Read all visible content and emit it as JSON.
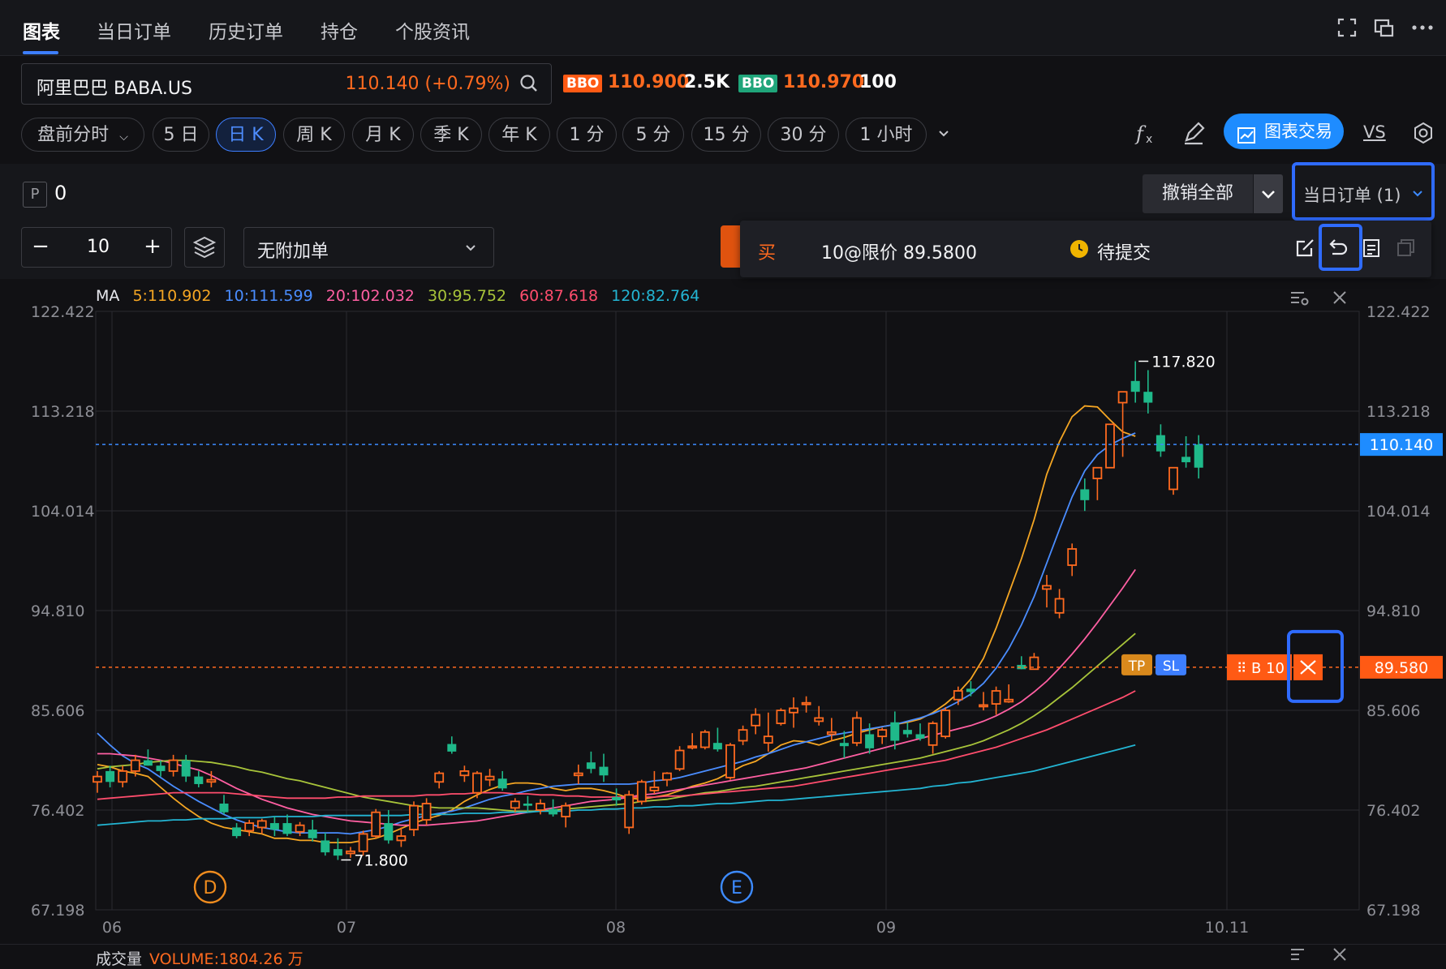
{
  "tabs": [
    {
      "label": "图表",
      "active": true
    },
    {
      "label": "当日订单",
      "active": false
    },
    {
      "label": "历史订单",
      "active": false
    },
    {
      "label": "持仓",
      "active": false
    },
    {
      "label": "个股资讯",
      "active": false
    }
  ],
  "top_icons": [
    "fullscreen-icon",
    "popout-icon",
    "more-icon"
  ],
  "symbol": {
    "name": "阿里巴巴 BABA.US",
    "price": "110.140 (+0.79%)"
  },
  "bbo": [
    {
      "tag": "BBO",
      "price": "110.900",
      "size": "2.5K",
      "color": "#ff6a1f"
    },
    {
      "tag": "BBO",
      "price": "110.970",
      "size": "100",
      "color": "#1fb98a"
    }
  ],
  "periods": [
    {
      "label": "盘前分时",
      "active": false,
      "dropdown": true
    },
    {
      "label": "5 日",
      "active": false
    },
    {
      "label": "日 K",
      "active": true
    },
    {
      "label": "周 K",
      "active": false
    },
    {
      "label": "月 K",
      "active": false
    },
    {
      "label": "季 K",
      "active": false
    },
    {
      "label": "年 K",
      "active": false
    },
    {
      "label": "1 分",
      "active": false
    },
    {
      "label": "5 分",
      "active": false
    },
    {
      "label": "15 分",
      "active": false
    },
    {
      "label": "30 分",
      "active": false
    },
    {
      "label": "1 小时",
      "active": false
    }
  ],
  "toolbar": {
    "chart_trade_label": "图表交易",
    "vs_label": "VS"
  },
  "position": {
    "badge": "P",
    "value": "0"
  },
  "orders_bar": {
    "cancel_all": "撤销全部",
    "today_orders": "当日订单 (1)"
  },
  "order_entry": {
    "minus": "−",
    "plus": "+",
    "quantity": "10",
    "addon_label": "无附加单"
  },
  "pending_order": {
    "side": "买",
    "desc": "10@限价 89.5800",
    "status": "待提交"
  },
  "legend": {
    "title": "MA",
    "items": [
      {
        "text": "5:110.902",
        "color": "#f5a623"
      },
      {
        "text": "10:111.599",
        "color": "#4a8dff"
      },
      {
        "text": "20:102.032",
        "color": "#ff5fa2"
      },
      {
        "text": "30:95.752",
        "color": "#a8c43a"
      },
      {
        "text": "60:87.618",
        "color": "#ff4d6d"
      },
      {
        "text": "120:82.764",
        "color": "#23b5d3"
      }
    ]
  },
  "chart_data": {
    "type": "candlestick",
    "ylim": [
      67.198,
      122.422
    ],
    "y_ticks": [
      "122.422",
      "113.218",
      "104.014",
      "94.810",
      "85.606",
      "76.402",
      "67.198"
    ],
    "x_ticks": [
      "06",
      "07",
      "08",
      "09",
      "10.11"
    ],
    "last_price": {
      "value": 110.14,
      "label": "110.140"
    },
    "order_price": {
      "value": 89.58,
      "label": "89.580"
    },
    "order_tag": "B 10",
    "tp_label": "TP",
    "sl_label": "SL",
    "high_marker": {
      "label": "117.820"
    },
    "low_marker": {
      "label": "71.800"
    },
    "events": [
      {
        "label": "D",
        "color": "#f08c1e"
      },
      {
        "label": "E",
        "color": "#3d8bff"
      }
    ],
    "up_color": "#ff6a1f",
    "down_color": "#1fb98a",
    "candles": [
      [
        79,
        80,
        78,
        79.5
      ],
      [
        80,
        80.5,
        78.5,
        79
      ],
      [
        79,
        80.5,
        78.5,
        80
      ],
      [
        80,
        81.5,
        79.5,
        81
      ],
      [
        81,
        82,
        80.5,
        80.5
      ],
      [
        80.5,
        81,
        79.5,
        80
      ],
      [
        80,
        81.5,
        79.5,
        81
      ],
      [
        81,
        81.5,
        79,
        79.5
      ],
      [
        79.5,
        80,
        78.5,
        78.8
      ],
      [
        79,
        80,
        78.5,
        79.2
      ],
      [
        77,
        77.8,
        76,
        76.2
      ],
      [
        74.8,
        75.2,
        73.8,
        74
      ],
      [
        74.5,
        75.5,
        74,
        75.2
      ],
      [
        74.8,
        75.6,
        74.2,
        75.4
      ],
      [
        75.2,
        75.8,
        74,
        74.6
      ],
      [
        75.2,
        76,
        74,
        74.2
      ],
      [
        74.4,
        75.3,
        74,
        75
      ],
      [
        74.6,
        75.5,
        73.5,
        73.8
      ],
      [
        73.6,
        74.3,
        72.2,
        72.5
      ],
      [
        72.8,
        73.8,
        71.8,
        72.2
      ],
      [
        72.4,
        73,
        72,
        72.6
      ],
      [
        72.6,
        74.5,
        72.2,
        74.2
      ],
      [
        74,
        76.5,
        73.8,
        76.2
      ],
      [
        75.2,
        76.4,
        73.3,
        73.6
      ],
      [
        73.6,
        74.8,
        73,
        74
      ],
      [
        74.6,
        77.2,
        74,
        76.8
      ],
      [
        75.5,
        77.5,
        75,
        77
      ],
      [
        79,
        80,
        78.4,
        79.8
      ],
      [
        82.5,
        83.2,
        81.6,
        81.8
      ],
      [
        79.6,
        80.5,
        79,
        80
      ],
      [
        78,
        80,
        77.5,
        79.8
      ],
      [
        79.2,
        80.2,
        78.6,
        79.5
      ],
      [
        79.3,
        80,
        78.2,
        78.4
      ],
      [
        76.6,
        77.5,
        76.2,
        77.2
      ],
      [
        77,
        77.7,
        76.2,
        76.8
      ],
      [
        76.4,
        77.4,
        76,
        77
      ],
      [
        76.5,
        77.4,
        75.8,
        76
      ],
      [
        75.8,
        77.1,
        74.8,
        76.8
      ],
      [
        79.6,
        80.6,
        78.8,
        79.8
      ],
      [
        80.8,
        81.8,
        79.8,
        80.2
      ],
      [
        80.4,
        81.6,
        79,
        79.6
      ],
      [
        77.6,
        78.4,
        76.8,
        77.3
      ],
      [
        74.8,
        78.2,
        74.2,
        77.8
      ],
      [
        77.2,
        79.2,
        76.9,
        79
      ],
      [
        78.2,
        80,
        77.9,
        78.5
      ],
      [
        79.2,
        79.9,
        78.6,
        79.8
      ],
      [
        80.2,
        82.3,
        80,
        81.9
      ],
      [
        82.2,
        83.5,
        82,
        82.3
      ],
      [
        82.2,
        83.8,
        82,
        83.6
      ],
      [
        82.6,
        84,
        81.8,
        82
      ],
      [
        79.4,
        82.6,
        79.2,
        82.4
      ],
      [
        82.8,
        84.2,
        82.4,
        83.8
      ],
      [
        84.2,
        85.8,
        83.4,
        85.2
      ],
      [
        82.6,
        85.4,
        81.8,
        83.2
      ],
      [
        84.4,
        85.8,
        84.2,
        85.6
      ],
      [
        85.4,
        86.8,
        84,
        85.8
      ],
      [
        86.2,
        86.9,
        85.4,
        86.3
      ],
      [
        84.6,
        86,
        84.2,
        84.9
      ],
      [
        83.4,
        84.9,
        82.8,
        83.6
      ],
      [
        82.6,
        83.7,
        81.2,
        82.3
      ],
      [
        82.6,
        85.5,
        82.3,
        84.9
      ],
      [
        83.4,
        84.4,
        81.6,
        82.1
      ],
      [
        83.2,
        84,
        82.5,
        83.8
      ],
      [
        84.5,
        85.5,
        82,
        82.8
      ],
      [
        83.8,
        84.5,
        83.1,
        83.4
      ],
      [
        83.4,
        84.4,
        82.8,
        83
      ],
      [
        82.4,
        84.6,
        81.6,
        84.4
      ],
      [
        83.2,
        85.9,
        83,
        85.6
      ],
      [
        86.6,
        87.8,
        86.1,
        87.4
      ],
      [
        87.6,
        88.3,
        86.9,
        87.3
      ],
      [
        86,
        87.3,
        85.6,
        86.1
      ],
      [
        86.2,
        87.8,
        85.2,
        87.4
      ],
      [
        86.4,
        88,
        86.3,
        86.6
      ],
      [
        89.8,
        90.6,
        89.4,
        89.4
      ],
      [
        89.4,
        90.9,
        89.6,
        90.5
      ],
      [
        96.8,
        98.1,
        95.1,
        97.1
      ],
      [
        94.6,
        96.8,
        94.1,
        95.9
      ],
      [
        99,
        101,
        98,
        100.5
      ],
      [
        106,
        107,
        104,
        105
      ],
      [
        107,
        108,
        105,
        108
      ],
      [
        108,
        112,
        108,
        112
      ],
      [
        114,
        115,
        109,
        115
      ],
      [
        116,
        117.82,
        114,
        115
      ],
      [
        115,
        117,
        113,
        114
      ],
      [
        111,
        112,
        109,
        109.5
      ],
      [
        106,
        108,
        105.5,
        108
      ],
      [
        109,
        110.9,
        108,
        108.5
      ],
      [
        110.14,
        111,
        107,
        108
      ]
    ],
    "ma_series": [
      {
        "name": "MA5",
        "color": "#f5a623",
        "values": [
          80.6,
          80.4,
          80,
          79.8,
          79.5,
          78.5,
          77.5,
          76.6,
          75.8,
          75.2,
          74.8,
          74.6,
          74.4,
          74.2,
          73.8,
          73.8,
          73.6,
          73.6,
          73.4,
          73.4,
          73.4,
          73.6,
          73.8,
          74.2,
          74.7,
          75.2,
          75.6,
          75.9,
          76.4,
          77.2,
          77.8,
          78.3,
          78.7,
          78.9,
          78.9,
          78.8,
          78.4,
          78.2,
          78.4,
          78.4,
          78.2,
          77.9,
          77.5,
          77.4,
          77.6,
          77.8,
          78.2,
          78.6,
          78.9,
          79.3,
          79.9,
          80.5,
          80.9,
          81.6,
          82.4,
          82.8,
          82.7,
          82.4,
          82.8,
          83.1,
          83.5,
          83.8,
          84.1,
          84.3,
          84.5,
          84.8,
          85.4,
          86.2,
          87.2,
          88.5,
          90.4,
          93.2,
          96.4,
          99.6,
          103.2,
          107.4,
          110.4,
          112.7,
          113.7,
          113.6,
          112.4,
          111.3,
          110.9
        ]
      },
      {
        "name": "MA10",
        "color": "#4a8dff",
        "values": [
          83.5,
          82.4,
          81.4,
          80.7,
          80.2,
          79.4,
          78.6,
          77.9,
          77.2,
          76.6,
          76,
          75.5,
          75.1,
          74.8,
          74.6,
          74.4,
          74.3,
          74.3,
          74.3,
          74.3,
          74.2,
          74.4,
          74.6,
          74.9,
          75.3,
          75.6,
          75.9,
          76.1,
          76.3,
          76.6,
          77,
          77.4,
          77.7,
          77.9,
          78.2,
          78.4,
          78.6,
          78.7,
          78.8,
          78.8,
          78.8,
          78.8,
          78.8,
          78.9,
          79.1,
          79.2,
          79.4,
          79.7,
          80,
          80.3,
          80.6,
          80.9,
          81.3,
          81.6,
          82,
          82.4,
          82.7,
          83,
          83.3,
          83.5,
          83.7,
          83.9,
          84.1,
          84.3,
          84.6,
          84.9,
          85.3,
          85.8,
          86.4,
          87.1,
          88.1,
          89.5,
          91.3,
          93.5,
          96.1,
          99.2,
          102.3,
          105.3,
          107.7,
          109.2,
          110.1,
          110.7,
          111.2
        ]
      },
      {
        "name": "MA20",
        "color": "#ff5fa2",
        "values": [
          81.6,
          81.6,
          81.5,
          81.4,
          81.2,
          81,
          80.7,
          80.4,
          80.1,
          79.6,
          79,
          78.4,
          77.9,
          77.4,
          77,
          76.6,
          76.3,
          76,
          75.8,
          75.6,
          75.4,
          75.3,
          75.2,
          75.1,
          75,
          75,
          75,
          75.1,
          75.2,
          75.3,
          75.4,
          75.6,
          75.8,
          76,
          76.2,
          76.4,
          76.6,
          76.8,
          77,
          77.2,
          77.3,
          77.4,
          77.6,
          77.8,
          77.9,
          78.1,
          78.3,
          78.5,
          78.7,
          78.9,
          79.1,
          79.3,
          79.5,
          79.7,
          79.9,
          80.1,
          80.3,
          80.6,
          80.9,
          81.2,
          81.5,
          81.8,
          82.1,
          82.4,
          82.7,
          83,
          83.3,
          83.6,
          83.9,
          84.2,
          84.6,
          85.1,
          85.7,
          86.4,
          87.3,
          88.3,
          89.5,
          90.8,
          92.2,
          93.7,
          95.3,
          96.9,
          98.6
        ]
      },
      {
        "name": "MA30",
        "color": "#a8c43a",
        "values": [
          80.2,
          80.4,
          80.5,
          80.6,
          80.8,
          80.9,
          81,
          81,
          80.9,
          80.8,
          80.6,
          80.4,
          80.1,
          79.9,
          79.6,
          79.3,
          79.1,
          78.8,
          78.5,
          78.2,
          77.9,
          77.6,
          77.4,
          77.2,
          77,
          76.8,
          76.7,
          76.6,
          76.6,
          76.6,
          76.6,
          76.5,
          76.4,
          76.3,
          76.3,
          76.3,
          76.4,
          76.5,
          76.6,
          76.7,
          76.8,
          76.9,
          77,
          77.2,
          77.3,
          77.4,
          77.6,
          77.8,
          78,
          78.1,
          78.3,
          78.5,
          78.6,
          78.8,
          79,
          79.2,
          79.4,
          79.6,
          79.8,
          80,
          80.2,
          80.4,
          80.6,
          80.8,
          81,
          81.2,
          81.5,
          81.8,
          82.1,
          82.4,
          82.8,
          83.3,
          83.8,
          84.4,
          85.1,
          85.9,
          86.8,
          87.7,
          88.7,
          89.7,
          90.7,
          91.7,
          92.7
        ]
      },
      {
        "name": "MA60",
        "color": "#ff4d6d",
        "values": [
          77.4,
          77.5,
          77.6,
          77.7,
          77.8,
          77.9,
          78,
          78,
          78,
          78,
          78,
          77.9,
          77.8,
          77.7,
          77.6,
          77.5,
          77.5,
          77.5,
          77.5,
          77.6,
          77.6,
          77.7,
          77.7,
          77.7,
          77.7,
          77.7,
          77.8,
          77.8,
          77.9,
          77.9,
          78,
          78,
          78,
          77.9,
          77.9,
          77.8,
          77.8,
          77.7,
          77.7,
          77.6,
          77.6,
          77.6,
          77.6,
          77.6,
          77.6,
          77.7,
          77.7,
          77.8,
          77.9,
          78,
          78.1,
          78.2,
          78.3,
          78.4,
          78.5,
          78.6,
          78.8,
          79,
          79.2,
          79.4,
          79.6,
          79.8,
          80,
          80.2,
          80.4,
          80.6,
          80.8,
          81,
          81.3,
          81.6,
          81.9,
          82.2,
          82.6,
          83,
          83.4,
          83.8,
          84.3,
          84.8,
          85.3,
          85.8,
          86.3,
          86.8,
          87.4
        ]
      },
      {
        "name": "MA120",
        "color": "#23b5d3",
        "values": [
          75,
          75.1,
          75.2,
          75.3,
          75.4,
          75.4,
          75.5,
          75.5,
          75.6,
          75.6,
          75.6,
          75.7,
          75.7,
          75.7,
          75.8,
          75.8,
          75.8,
          75.8,
          75.9,
          75.9,
          75.9,
          75.9,
          75.9,
          75.9,
          75.9,
          76,
          76,
          76,
          76,
          76.1,
          76.1,
          76.1,
          76.2,
          76.2,
          76.2,
          76.3,
          76.3,
          76.3,
          76.4,
          76.4,
          76.5,
          76.5,
          76.6,
          76.6,
          76.7,
          76.7,
          76.8,
          76.8,
          76.9,
          77,
          77,
          77.1,
          77.2,
          77.3,
          77.3,
          77.4,
          77.5,
          77.6,
          77.7,
          77.8,
          77.9,
          78,
          78.1,
          78.2,
          78.3,
          78.4,
          78.6,
          78.7,
          78.9,
          79,
          79.2,
          79.4,
          79.6,
          79.8,
          80,
          80.3,
          80.6,
          80.9,
          81.2,
          81.5,
          81.8,
          82.1,
          82.4
        ]
      }
    ]
  },
  "volume": {
    "title": "成交量",
    "value": "VOLUME:1804.26 万"
  }
}
